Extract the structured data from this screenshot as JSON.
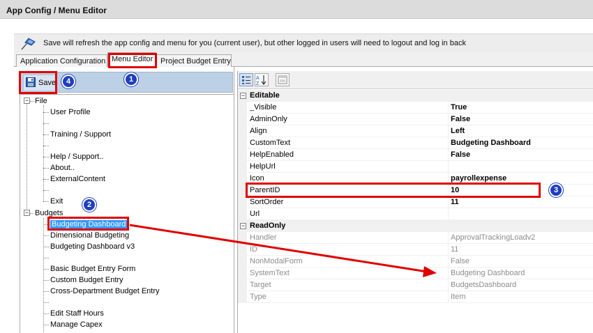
{
  "window": {
    "title": "App Config / Menu Editor"
  },
  "infobar": {
    "message": "Save will refresh the app config and menu for you (current user), but other logged in users will need to logout and log in back"
  },
  "tabs": [
    {
      "label": "Application Configuration"
    },
    {
      "label": "Menu Editor"
    },
    {
      "label": "Project Budget Entry"
    }
  ],
  "toolbar": {
    "save_label": "Save"
  },
  "tree": {
    "file": {
      "label": "File",
      "items": [
        "User Profile",
        "",
        "Training / Support",
        "",
        "Help / Support..",
        "About..",
        "ExternalContent",
        "",
        "Exit"
      ]
    },
    "budgets": {
      "label": "Budgets",
      "items": [
        "Budgeting Dashboard",
        "Dimensional Budgeting",
        "Budgeting Dashboard v3",
        "",
        "Basic Budget Entry Form",
        "Custom Budget Entry",
        "Cross-Department Budget Entry",
        "",
        "Edit Staff Hours",
        "Manage Capex"
      ]
    }
  },
  "properties": {
    "editable": {
      "label": "Editable",
      "rows": [
        {
          "name": "_Visible",
          "value": "True"
        },
        {
          "name": "AdminOnly",
          "value": "False"
        },
        {
          "name": "Align",
          "value": "Left"
        },
        {
          "name": "CustomText",
          "value": "Budgeting Dashboard"
        },
        {
          "name": "HelpEnabled",
          "value": "False"
        },
        {
          "name": "HelpUrl",
          "value": ""
        },
        {
          "name": "Icon",
          "value": "payrollexpense"
        },
        {
          "name": "ParentID",
          "value": "10"
        },
        {
          "name": "SortOrder",
          "value": "11"
        },
        {
          "name": "Url",
          "value": ""
        }
      ]
    },
    "readonly": {
      "label": "ReadOnly",
      "rows": [
        {
          "name": "Handler",
          "value": "ApprovalTrackingLoadv2"
        },
        {
          "name": "ID",
          "value": "11"
        },
        {
          "name": "NonModalForm",
          "value": "False"
        },
        {
          "name": "SystemText",
          "value": "Budgeting Dashboard"
        },
        {
          "name": "Target",
          "value": "BudgetsDashboard"
        },
        {
          "name": "Type",
          "value": "Item"
        }
      ]
    }
  },
  "annotations": {
    "badges": [
      "1",
      "2",
      "3",
      "4"
    ]
  },
  "colors": {
    "highlight": "#e00000",
    "badge": "#1f3fbf",
    "selection": "#3399ff",
    "toolbar": "#bcd0e6"
  },
  "icons": {
    "infobar": "pushpin-icon",
    "save": "floppy-disk-icon",
    "categorized": "categorized-view-icon",
    "alphabetical": "alphabetical-sort-icon",
    "pages": "property-pages-icon"
  }
}
